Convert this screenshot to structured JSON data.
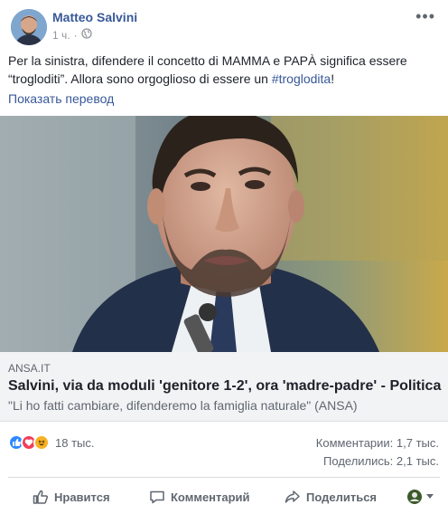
{
  "post": {
    "author": "Matteo Salvini",
    "time": "1 ч.",
    "audience_icon": "globe-icon",
    "more_icon": "more-dots-icon",
    "text_before": "Per la sinistra, difendere il concetto di MAMMA e PAPÀ significa essere “trogloditi”. Allora sono orgoglioso di essere un ",
    "hashtag": "#troglodita",
    "text_after": "!",
    "translate_label": "Показать перевод"
  },
  "link": {
    "domain": "ANSA.IT",
    "title": "Salvini, via da moduli 'genitore 1-2', ora 'madre-padre' - Politica",
    "description": "\"Li ho fatti cambiare, difenderemo la famiglia naturale\" (ANSA)"
  },
  "stats": {
    "reactions_count": "18 тыс.",
    "comments": "Комментарии: 1,7 тыс.",
    "shares": "Поделились: 2,1 тыс.",
    "reaction_icons": [
      "like-icon",
      "love-icon",
      "haha-icon"
    ]
  },
  "actions": {
    "like": "Нравится",
    "comment": "Комментарий",
    "share": "Поделиться"
  },
  "colors": {
    "link_blue": "#385898",
    "like_blue": "#2d88ff",
    "love_red": "#f33e58",
    "haha_yellow": "#f7b125"
  }
}
